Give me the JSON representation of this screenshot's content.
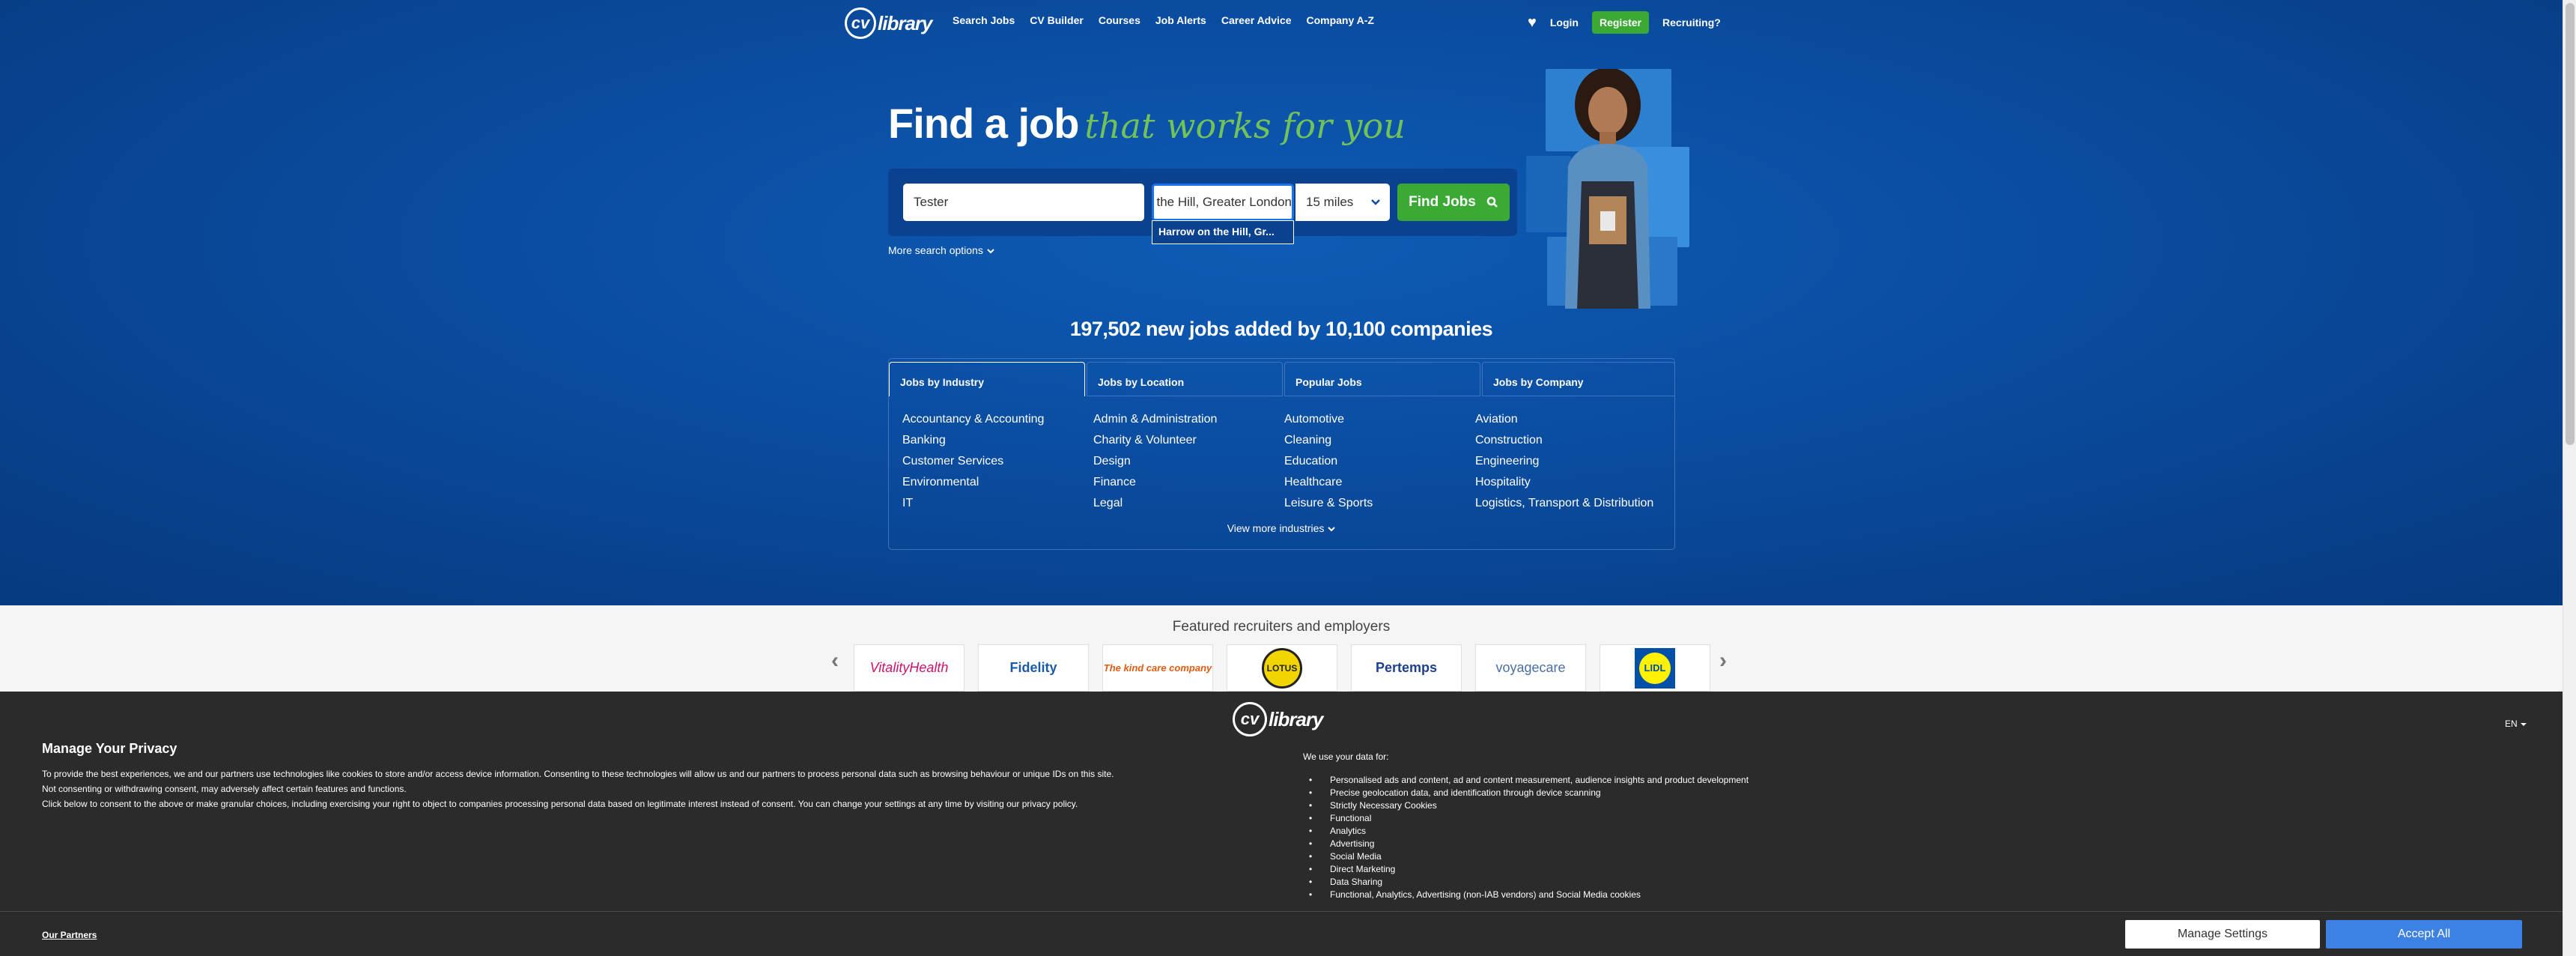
{
  "brand": {
    "logo_mark": "cv",
    "logo_text": "library"
  },
  "nav": {
    "links": [
      "Search Jobs",
      "CV Builder",
      "Courses",
      "Job Alerts",
      "Career Advice",
      "Company A-Z"
    ],
    "login": "Login",
    "register": "Register",
    "recruiting": "Recruiting?",
    "saved_icon": "heart-icon"
  },
  "hero": {
    "headline_main": "Find a job",
    "headline_accent": "that works for you"
  },
  "search": {
    "keywords_value": "Tester",
    "location_value": "Harrow on the Hill, Greater London",
    "radius_value": "15 miles",
    "find_button": "Find Jobs",
    "suggestion": "Harrow on the Hill, Gr...",
    "more_options": "More search options"
  },
  "stats": {
    "text": "197,502 new jobs added by 10,100 companies"
  },
  "browse": {
    "tabs": [
      "Jobs by Industry",
      "Jobs by Location",
      "Popular Jobs",
      "Jobs by Company"
    ],
    "active_tab": "Jobs by Industry",
    "columns": [
      [
        "Accountancy & Accounting",
        "Banking",
        "Customer Services",
        "Environmental",
        "IT"
      ],
      [
        "Admin & Administration",
        "Charity & Volunteer",
        "Design",
        "Finance",
        "Legal"
      ],
      [
        "Automotive",
        "Cleaning",
        "Education",
        "Healthcare",
        "Leisure & Sports"
      ],
      [
        "Aviation",
        "Construction",
        "Engineering",
        "Hospitality",
        "Logistics, Transport & Distribution"
      ]
    ],
    "view_more": "View more industries"
  },
  "featured": {
    "title": "Featured recruiters and employers",
    "logos": [
      "VitalityHealth",
      "Fidelity",
      "The kind care company",
      "LOTUS",
      "Pertemps",
      "voyagecare",
      "LIDL"
    ]
  },
  "cookie": {
    "title": "Manage Your Privacy",
    "text": [
      "To provide the best experiences, we and our partners use technologies like cookies to store and/or access device information. Consenting to these technologies will allow us and our partners to process personal data such as browsing behaviour or unique IDs on this site.",
      "Not consenting or withdrawing consent, may adversely affect certain features and functions.",
      "Click below to consent to the above or make granular choices, including exercising your right to object to companies processing personal data based on legitimate interest instead of consent. You can change your settings at any time by visiting our privacy policy."
    ],
    "language": "EN",
    "use_title": "We use your data for:",
    "uses": [
      "Personalised ads and content, ad and content measurement, audience insights and product development",
      "Precise geolocation data, and identification through device scanning",
      "Strictly Necessary Cookies",
      "Functional",
      "Analytics",
      "Advertising",
      "Social Media",
      "Direct Marketing",
      "Data Sharing",
      "Functional, Analytics, Advertising (non-IAB vendors) and Social Media cookies"
    ],
    "partners_link": "Our Partners",
    "manage_button": "Manage Settings",
    "accept_button": "Accept All"
  },
  "colors": {
    "brand_blue": "#0a4c9f",
    "accent_green": "#3aaa35",
    "accept_blue": "#3d82e2",
    "cookie_bg": "#2b2b2b"
  }
}
